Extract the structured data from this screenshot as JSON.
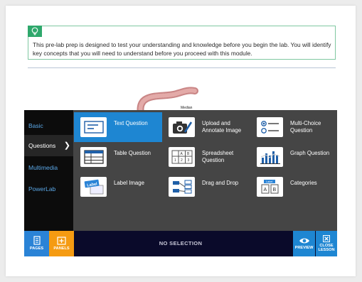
{
  "tip": {
    "icon": "lightbulb-icon",
    "accent_color": "#2fa86c",
    "text": "This pre-lab prep is designed to test your understanding and knowledge before you begin the lab. You will identify key concepts that you will need to understand before you proceed with this module."
  },
  "figure": {
    "label": "Median"
  },
  "sidebar": {
    "items": [
      {
        "label": "Basic"
      },
      {
        "label": "Questions"
      },
      {
        "label": "Multimedia"
      },
      {
        "label": "PowerLab"
      }
    ],
    "active_index": 1,
    "active_chevron": "❯"
  },
  "question_types": [
    {
      "label": "Text Question",
      "icon": "text-question-icon"
    },
    {
      "label": "Upload and Annotate Image",
      "icon": "camera-annotate-icon"
    },
    {
      "label": "Multi-Choice Question",
      "icon": "multi-choice-icon"
    },
    {
      "label": "Table Question",
      "icon": "table-icon"
    },
    {
      "label": "Spreadsheet Question",
      "icon": "spreadsheet-icon"
    },
    {
      "label": "Graph Question",
      "icon": "graph-icon"
    },
    {
      "label": "Label Image",
      "icon": "label-image-icon"
    },
    {
      "label": "Drag and Drop",
      "icon": "drag-drop-icon"
    },
    {
      "label": "Categories",
      "icon": "categories-icon"
    }
  ],
  "selected_question_type": "Text Question",
  "icon_glyphs": {
    "spreadsheet_cells": [
      "A",
      "B",
      "1",
      "2",
      "3"
    ],
    "label_tag": "Label",
    "categories_tag": "Label",
    "categories_boxes": [
      "A",
      "B"
    ]
  },
  "bottom_bar": {
    "pages_label": "PAGES",
    "panels_label": "PANELS",
    "status": "NO SELECTION",
    "preview_label": "PREVIEW",
    "close_label": "CLOSE LESSON"
  },
  "colors": {
    "panel_bg": "#454545",
    "sidebar_bg": "#0c0c0c",
    "link_blue": "#5ba8e8",
    "selected_blue": "#1e86d2",
    "pages_button": "#2a83d6",
    "panels_button": "#f59b12",
    "preview_button": "#1e86d2",
    "close_button": "#1e86d2",
    "bottom_bar": "#0a0a2a"
  }
}
